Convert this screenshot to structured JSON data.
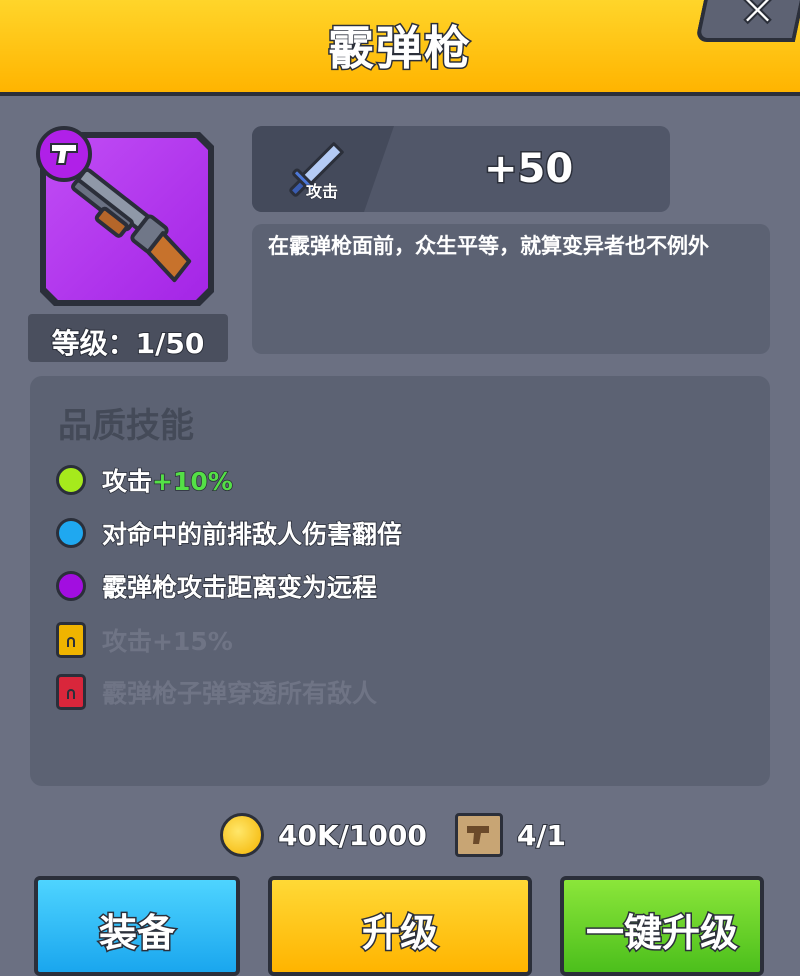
{
  "header": {
    "title": "霰弹枪",
    "close_icon": "close-icon"
  },
  "weapon": {
    "icon": "shotgun-icon",
    "type_badge_icon": "pistol-icon",
    "level_text": "等级：1/50",
    "tile_color": "#b63cf0"
  },
  "stat": {
    "icon": "sword-icon",
    "label": "攻击",
    "value": "+50"
  },
  "description": "在霰弹枪面前，众生平等，就算变异者也不例外",
  "skills": {
    "title": "品质技能",
    "items": [
      {
        "prefix": "攻击",
        "bonus": "+10%",
        "dot_color": "#a6ea1c",
        "locked": false
      },
      {
        "prefix": "对命中的前排敌人伤害翻倍",
        "bonus": "",
        "dot_color": "#1fa8f0",
        "locked": false
      },
      {
        "prefix": "霰弹枪攻击距离变为远程",
        "bonus": "",
        "dot_color": "#a20ee0",
        "locked": false
      },
      {
        "prefix": "攻击+15%",
        "bonus": "",
        "lock_color": "#f0b400",
        "locked": true
      },
      {
        "prefix": "霰弹枪子弹穿透所有敌人",
        "bonus": "",
        "lock_color": "#d9263b",
        "locked": true
      }
    ]
  },
  "costs": {
    "coin_icon": "coin-icon",
    "coins": "40K/1000",
    "blueprint_icon": "blueprint-icon",
    "blueprints": "4/1"
  },
  "buttons": {
    "equip": "装备",
    "upgrade": "升级",
    "one_click_upgrade": "一键升级"
  }
}
